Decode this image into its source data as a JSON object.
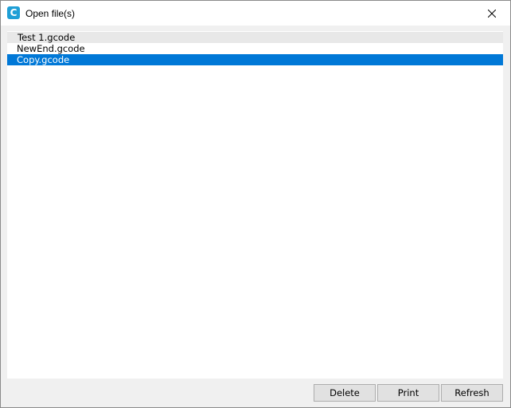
{
  "window": {
    "title": "Open file(s)",
    "app_icon": "cura-icon",
    "close_icon": "close-icon"
  },
  "file_list": {
    "items": [
      {
        "label": "Test 1.gcode",
        "selected": false
      },
      {
        "label": "NewEnd.gcode",
        "selected": false
      },
      {
        "label": "Copy.gcode",
        "selected": true
      }
    ]
  },
  "buttons": {
    "delete_label": "Delete",
    "print_label": "Print",
    "refresh_label": "Refresh"
  },
  "colors": {
    "selection": "#0078d7",
    "app_icon": "#1f9fd6"
  }
}
